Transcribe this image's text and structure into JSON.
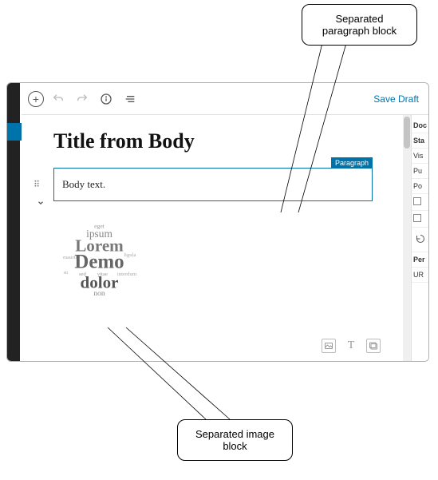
{
  "callouts": {
    "top": "Separated paragraph block",
    "bottom": "Separated image block"
  },
  "toolbar": {
    "save_draft": "Save Draft"
  },
  "editor": {
    "title": "Title from Body",
    "paragraph_text": "Body text.",
    "block_type_label": "Paragraph"
  },
  "sidebar": {
    "tab": "Doc",
    "sections": {
      "status": "Sta",
      "visibility": "Vis",
      "publish": "Pu",
      "post": "Po",
      "permalink": "Per",
      "url": "UR"
    }
  },
  "icons": {
    "add": "+",
    "image_alt": "Word cloud with Lorem Ipsum Demo dolor text"
  }
}
